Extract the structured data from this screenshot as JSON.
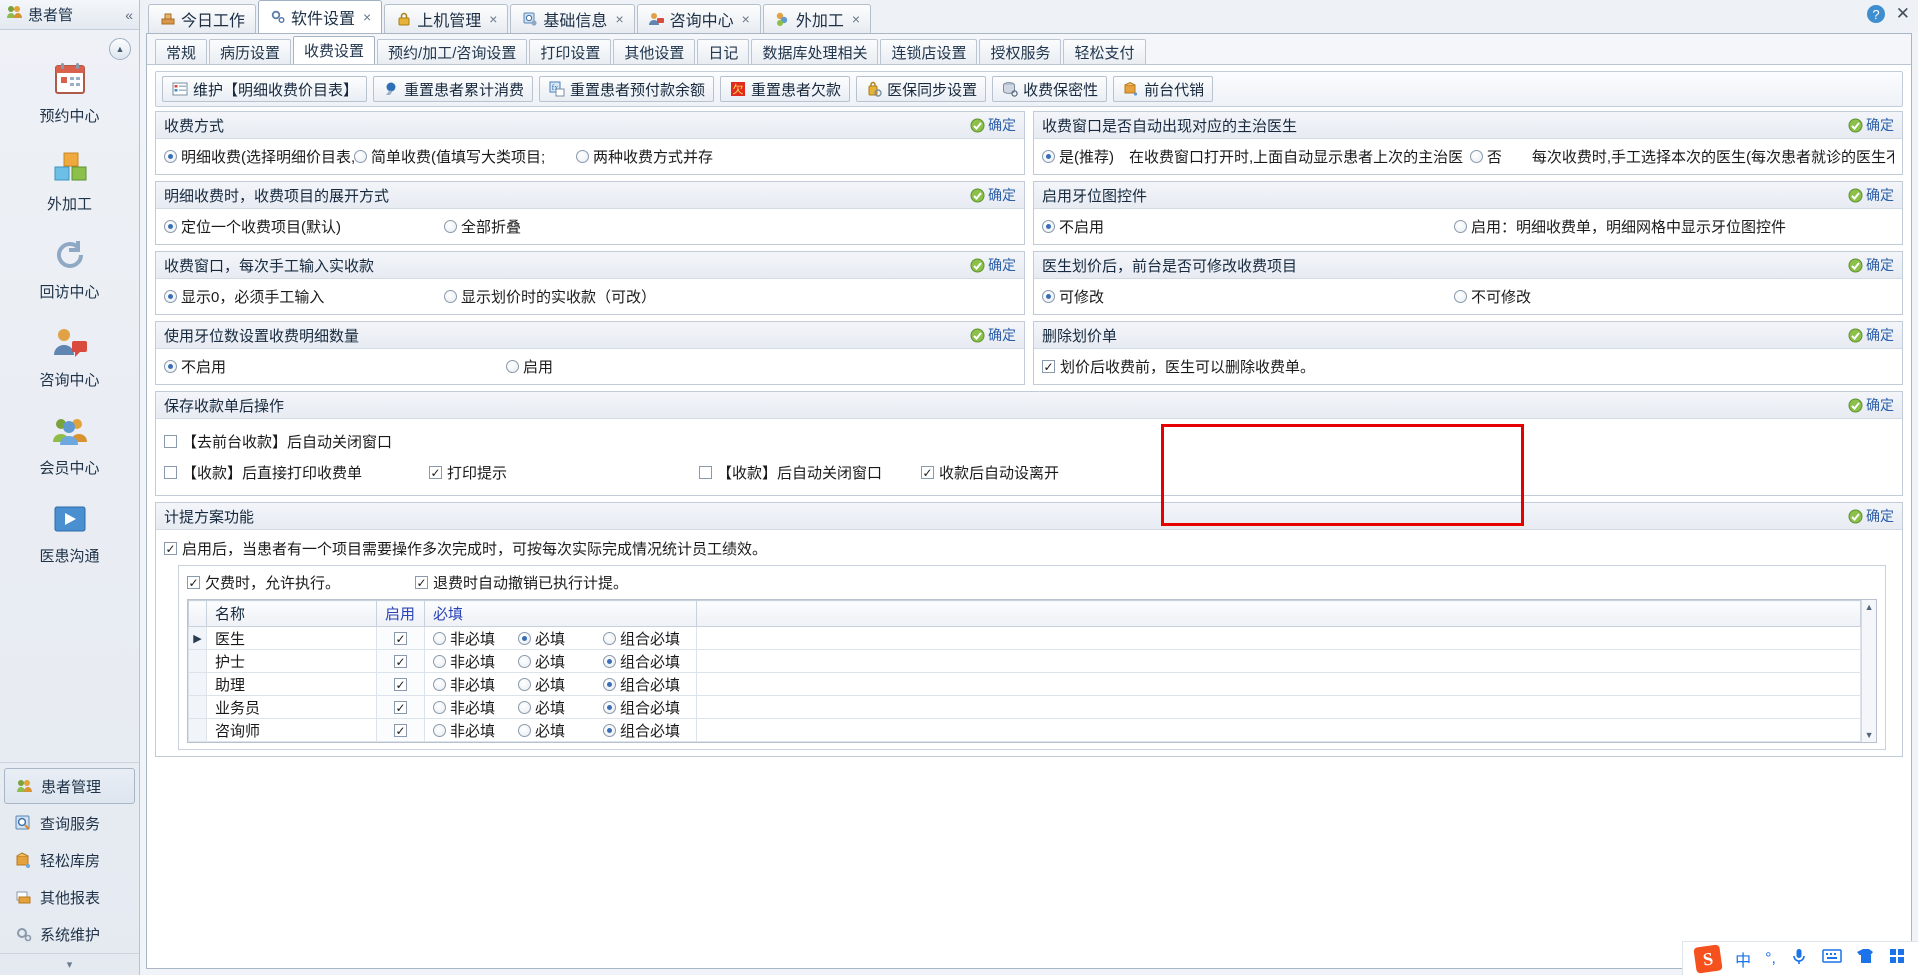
{
  "sidebar": {
    "header_title": "患者管",
    "collapse_icon": "double-chevron-left-icon",
    "big_items": [
      {
        "label": "预约中心",
        "icon": "calendar-icon"
      },
      {
        "label": "外加工",
        "icon": "boxes-icon"
      },
      {
        "label": "回访中心",
        "icon": "refresh-icon"
      },
      {
        "label": "咨询中心",
        "icon": "consult-person-icon"
      },
      {
        "label": "会员中心",
        "icon": "members-icon"
      },
      {
        "label": "医患沟通",
        "icon": "video-icon"
      }
    ],
    "small_items": [
      {
        "label": "患者管理",
        "icon": "patients-icon",
        "active": true
      },
      {
        "label": "查询服务",
        "icon": "search-icon",
        "active": false
      },
      {
        "label": "轻松库房",
        "icon": "warehouse-icon",
        "active": false
      },
      {
        "label": "其他报表",
        "icon": "report-icon",
        "active": false
      },
      {
        "label": "系统维护",
        "icon": "gear-icon",
        "active": false
      }
    ]
  },
  "window_tabs": [
    {
      "label": "今日工作",
      "icon": "today-icon",
      "closable": false,
      "active": false
    },
    {
      "label": "软件设置",
      "icon": "settings-icon",
      "closable": true,
      "active": true
    },
    {
      "label": "上机管理",
      "icon": "lock-icon",
      "closable": true,
      "active": false
    },
    {
      "label": "基础信息",
      "icon": "info-icon",
      "closable": true,
      "active": false
    },
    {
      "label": "咨询中心",
      "icon": "consult-icon",
      "closable": true,
      "active": false
    },
    {
      "label": "外加工",
      "icon": "outwork-icon",
      "closable": true,
      "active": false
    }
  ],
  "window_controls": {
    "help": "?",
    "close": "✕"
  },
  "inner_tabs": [
    {
      "label": "常规",
      "active": false
    },
    {
      "label": "病历设置",
      "active": false
    },
    {
      "label": "收费设置",
      "active": true
    },
    {
      "label": "预约/加工/咨询设置",
      "active": false
    },
    {
      "label": "打印设置",
      "active": false
    },
    {
      "label": "其他设置",
      "active": false
    },
    {
      "label": "日记",
      "active": false
    },
    {
      "label": "数据库处理相关",
      "active": false
    },
    {
      "label": "连锁店设置",
      "active": false
    },
    {
      "label": "授权服务",
      "active": false
    },
    {
      "label": "轻松支付",
      "active": false
    }
  ],
  "toolbar": [
    {
      "label": "维护【明细收费价目表】",
      "icon": "list-icon"
    },
    {
      "label": "重置患者累计消费",
      "icon": "reset-blue-icon"
    },
    {
      "label": "重置患者预付款余额",
      "icon": "fx-icon"
    },
    {
      "label": "重置患者欠款",
      "icon": "owe-red-icon"
    },
    {
      "label": "医保同步设置",
      "icon": "insurance-lock-icon"
    },
    {
      "label": "收费保密性",
      "icon": "db-lock-icon"
    },
    {
      "label": "前台代销",
      "icon": "cart-box-icon"
    }
  ],
  "ok_label": "确定",
  "groups": {
    "charge_mode": {
      "title": "收费方式",
      "options": [
        {
          "label": "明细收费(选择明细价目表,",
          "checked": true
        },
        {
          "label": "简单收费(值填写大类项目;",
          "checked": false
        },
        {
          "label": "两种收费方式并存",
          "checked": false
        }
      ]
    },
    "auto_doctor": {
      "title": "收费窗口是否自动出现对应的主治医生",
      "options": [
        {
          "label": "是(推荐)　在收费窗口打开时,上面自动显示患者上次的主治医",
          "checked": true
        },
        {
          "label": "否　　每次收费时,手工选择本次的医生(每次患者就诊的医生不",
          "checked": false
        }
      ]
    },
    "expand_mode": {
      "title": "明细收费时，收费项目的展开方式",
      "options": [
        {
          "label": "定位一个收费项目(默认)",
          "checked": true
        },
        {
          "label": "全部折叠",
          "checked": false
        }
      ]
    },
    "tooth_widget": {
      "title": "启用牙位图控件",
      "options": [
        {
          "label": "不启用",
          "checked": true
        },
        {
          "label": "启用：明细收费单，明细网格中显示牙位图控件",
          "checked": false
        }
      ]
    },
    "manual_amount": {
      "title": "收费窗口，每次手工输入实收款",
      "options": [
        {
          "label": "显示0，必须手工输入",
          "checked": true
        },
        {
          "label": "显示划价时的实收款（可改）",
          "checked": false
        }
      ]
    },
    "front_modify": {
      "title": "医生划价后，前台是否可修改收费项目",
      "options": [
        {
          "label": "可修改",
          "checked": true
        },
        {
          "label": "不可修改",
          "checked": false
        }
      ]
    },
    "tooth_count": {
      "title": "使用牙位数设置收费明细数量",
      "options": [
        {
          "label": "不启用",
          "checked": true
        },
        {
          "label": "启用",
          "checked": false
        }
      ]
    },
    "delete_order": {
      "title": "删除划价单",
      "checkbox": {
        "label": "划价后收费前，医生可以删除收费单。",
        "checked": true
      }
    },
    "after_save": {
      "title": "保存收款单后操作",
      "row1": [
        {
          "label": "【去前台收款】后自动关闭窗口",
          "checked": false
        }
      ],
      "row2": [
        {
          "label": "【收款】后直接打印收费单",
          "checked": false
        },
        {
          "label": "打印提示",
          "checked": true
        },
        {
          "label": "【收款】后自动关闭窗口",
          "checked": false
        },
        {
          "label": "收款后自动设离开",
          "checked": true
        }
      ]
    },
    "commission": {
      "title": "计提方案功能",
      "enable": {
        "label": "启用后，当患者有一个项目需要操作多次完成时，可按每次实际完成情况统计员工绩效。",
        "checked": true
      },
      "sub_checks": [
        {
          "label": "欠费时，允许执行。",
          "checked": true
        },
        {
          "label": "退费时自动撤销已执行计提。",
          "checked": true
        }
      ],
      "table": {
        "columns": [
          "名称",
          "启用",
          "必填"
        ],
        "req_options": [
          "非必填",
          "必填",
          "组合必填"
        ],
        "rows": [
          {
            "indicator": "▶",
            "name": "医生",
            "enabled": true,
            "required": "必填"
          },
          {
            "indicator": "",
            "name": "护士",
            "enabled": true,
            "required": "组合必填"
          },
          {
            "indicator": "",
            "name": "助理",
            "enabled": true,
            "required": "组合必填"
          },
          {
            "indicator": "",
            "name": "业务员",
            "enabled": true,
            "required": "组合必填"
          },
          {
            "indicator": "",
            "name": "咨询师",
            "enabled": true,
            "required": "组合必填"
          }
        ]
      }
    }
  },
  "highlight": {
    "color": "#e60000"
  },
  "ime": {
    "logo": "S",
    "items": [
      "中",
      "°,",
      "mic-icon",
      "keyboard-icon",
      "skin-icon",
      "apps-icon"
    ]
  }
}
